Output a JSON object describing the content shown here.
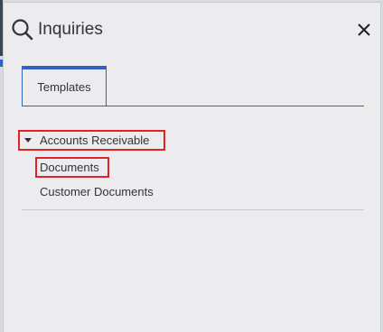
{
  "panel": {
    "title": "Inquiries",
    "search_icon": "search-icon",
    "close_icon": "close-icon"
  },
  "tabs": [
    {
      "label": "Templates",
      "active": true
    }
  ],
  "tree": {
    "group": {
      "label": "Accounts Receivable",
      "expanded": true,
      "icon": "caret-down-icon"
    },
    "items": [
      {
        "label": "Documents"
      },
      {
        "label": "Customer Documents"
      }
    ]
  },
  "colors": {
    "accent": "#2e63c4",
    "highlight": "#e0232b",
    "panel_bg": "#ececee"
  }
}
